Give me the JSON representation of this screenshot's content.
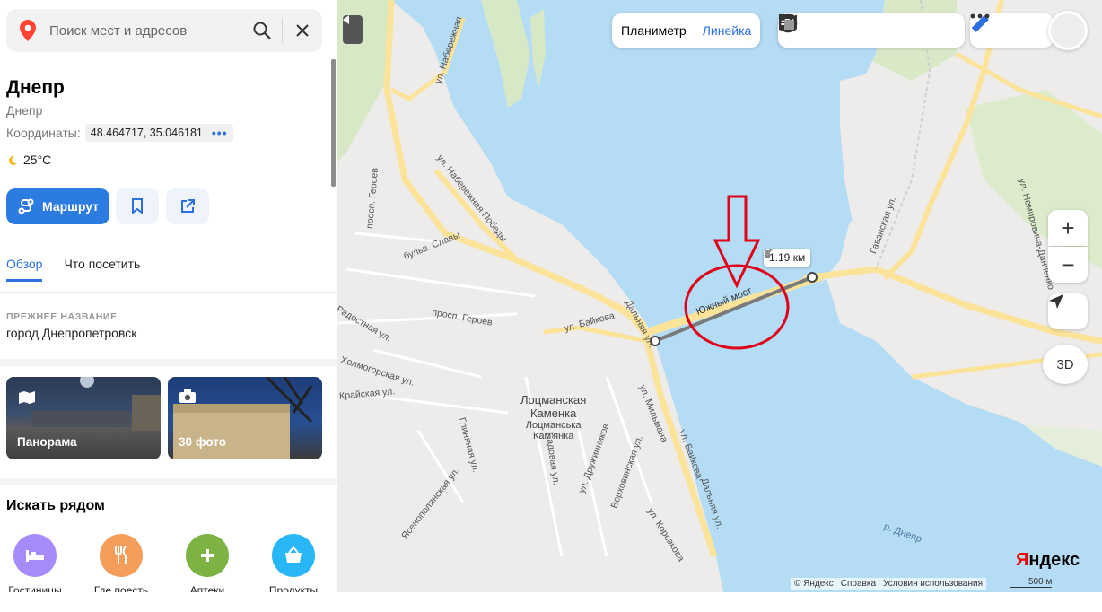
{
  "search": {
    "placeholder": "Поиск мест и адресов",
    "icons": [
      "map-pin-icon",
      "search-icon",
      "close-icon"
    ]
  },
  "place": {
    "title": "Днепр",
    "subtitle": "Днепр",
    "coords_label": "Координаты:",
    "coords_value": "48.464717, 35.046181",
    "coords_more": "•••",
    "weather": "25°C"
  },
  "actions": {
    "route_label": "Маршрут",
    "icons": [
      "route-icon",
      "bookmark-icon",
      "share-icon"
    ]
  },
  "tabs": [
    {
      "label": "Обзор",
      "active": true
    },
    {
      "label": "Что посетить",
      "active": false
    }
  ],
  "history": {
    "caption": "ПРЕЖНЕЕ НАЗВАНИЕ",
    "value": "город Днепропетровск"
  },
  "photos": [
    {
      "label": "Панорама",
      "icon": "panorama-icon"
    },
    {
      "label": "30 фото",
      "icon": "camera-icon"
    }
  ],
  "nearby": {
    "title": "Искать рядом",
    "items": [
      {
        "label": "Гостиницы",
        "color": "#a78bfa",
        "icon": "bed-icon"
      },
      {
        "label": "Где поесть",
        "color": "#f59e5b",
        "icon": "fork-knife-icon"
      },
      {
        "label": "Аптеки",
        "color": "#7cb342",
        "icon": "plus-icon"
      },
      {
        "label": "Продукты",
        "color": "#29b6f6",
        "icon": "basket-icon"
      }
    ]
  },
  "map": {
    "ruler_tabs": [
      {
        "label": "Планиметр",
        "active": false
      },
      {
        "label": "Линейка",
        "active": true
      }
    ],
    "layer_icons": [
      "traffic-icon",
      "panorama-layer-icon",
      "photo-layer-icon",
      "transport-icon",
      "layers-icon"
    ],
    "tool_icons": [
      "ruler-icon",
      "more-icon"
    ],
    "zoom_in": "+",
    "zoom_out": "−",
    "view_3d": "3D",
    "measurement": "1.19 км",
    "bridge_label": "Южный мост",
    "river_label": "р. Днепр",
    "district": [
      "Лоцманская",
      "Каменка",
      "Лоцманська",
      "Кам'янка"
    ],
    "streets": [
      "ул. Набережная",
      "ул. Набережная Победы",
      "просп. Героев",
      "бульв. Славы",
      "просп. Героев",
      "Радостная ул.",
      "Холмогорская ул.",
      "Крайская ул.",
      "ул. Байкова",
      "Дальняя ул.",
      "ул. Мильмана",
      "Глиняная ул.",
      "Ясенополянская ул.",
      "Садовая ул.",
      "ул. Дружинников",
      "Верховинская ул.",
      "ул. Корсакова",
      "Дальняя ул.",
      "Гаванская ул.",
      "ул. Немировича-Данченко",
      "ул. Байкова"
    ],
    "footer": [
      "© Яндекс",
      "Справка",
      "Условия использования"
    ],
    "scale": "500 м",
    "logo_y": "Я",
    "logo_rest": "ндекс",
    "colors": {
      "water": "#b5dcf5",
      "road": "#fbe39a",
      "annotation": "#e0001a",
      "arrow": "#f5c542",
      "accent": "#2b6fe0"
    }
  }
}
